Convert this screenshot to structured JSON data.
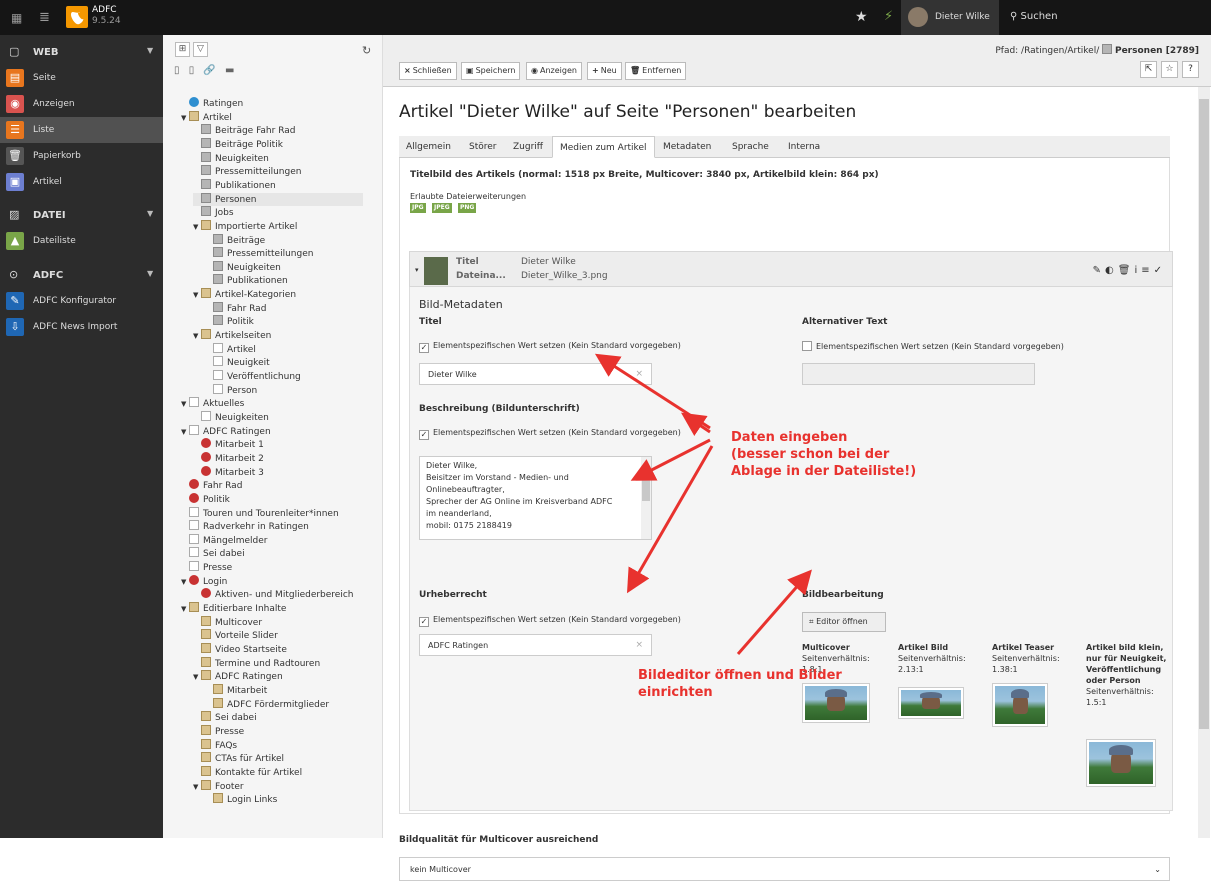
{
  "topbar": {
    "brand_name": "ADFC",
    "brand_version": "9.5.24",
    "user_name": "Dieter Wilke",
    "search_label": "Suchen"
  },
  "sidebar": {
    "groups": [
      {
        "label": "WEB",
        "items": [
          {
            "label": "Seite",
            "color": "#e8761e",
            "icon": "page-icon"
          },
          {
            "label": "Anzeigen",
            "color": "#d9534f",
            "icon": "view-icon"
          },
          {
            "label": "Liste",
            "color": "#e8761e",
            "icon": "list-icon",
            "active": true
          },
          {
            "label": "Papierkorb",
            "color": "#555555",
            "icon": "trash-icon"
          },
          {
            "label": "Artikel",
            "color": "#6d7fd1",
            "icon": "news-icon"
          }
        ]
      },
      {
        "label": "DATEI",
        "items": [
          {
            "label": "Dateiliste",
            "color": "#79a548",
            "icon": "filelist-icon"
          }
        ]
      },
      {
        "label": "ADFC",
        "items": [
          {
            "label": "ADFC Konfigurator",
            "color": "#1f67b4",
            "icon": "configurator-icon"
          },
          {
            "label": "ADFC News Import",
            "color": "#1f67b4",
            "icon": "import-icon"
          }
        ]
      }
    ]
  },
  "tree": {
    "nodes": [
      {
        "label": "Ratingen",
        "level": 0,
        "icon": "root"
      },
      {
        "label": "Artikel",
        "level": 0,
        "icon": "folder",
        "expanded": true
      },
      {
        "label": "Beiträge Fahr Rad",
        "level": 1,
        "icon": "art"
      },
      {
        "label": "Beiträge Politik",
        "level": 1,
        "icon": "art"
      },
      {
        "label": "Neuigkeiten",
        "level": 1,
        "icon": "art"
      },
      {
        "label": "Pressemitteilungen",
        "level": 1,
        "icon": "art"
      },
      {
        "label": "Publikationen",
        "level": 1,
        "icon": "art"
      },
      {
        "label": "Personen",
        "level": 1,
        "icon": "art",
        "selected": true
      },
      {
        "label": "Jobs",
        "level": 1,
        "icon": "art"
      },
      {
        "label": "Importierte Artikel",
        "level": 1,
        "icon": "folder",
        "expanded": true
      },
      {
        "label": "Beiträge",
        "level": 2,
        "icon": "art"
      },
      {
        "label": "Pressemitteilungen",
        "level": 2,
        "icon": "art"
      },
      {
        "label": "Neuigkeiten",
        "level": 2,
        "icon": "art"
      },
      {
        "label": "Publikationen",
        "level": 2,
        "icon": "art"
      },
      {
        "label": "Artikel-Kategorien",
        "level": 1,
        "icon": "folder",
        "expanded": true
      },
      {
        "label": "Fahr Rad",
        "level": 2,
        "icon": "art"
      },
      {
        "label": "Politik",
        "level": 2,
        "icon": "art"
      },
      {
        "label": "Artikelseiten",
        "level": 1,
        "icon": "folder",
        "expanded": true
      },
      {
        "label": "Artikel",
        "level": 2,
        "icon": "page"
      },
      {
        "label": "Neuigkeit",
        "level": 2,
        "icon": "page"
      },
      {
        "label": "Veröffentlichung",
        "level": 2,
        "icon": "page"
      },
      {
        "label": "Person",
        "level": 2,
        "icon": "page"
      },
      {
        "label": "Aktuelles",
        "level": 0,
        "icon": "page",
        "expanded": true
      },
      {
        "label": "Neuigkeiten",
        "level": 1,
        "icon": "page"
      },
      {
        "label": "ADFC Ratingen",
        "level": 0,
        "icon": "page",
        "expanded": true
      },
      {
        "label": "Mitarbeit 1",
        "level": 1,
        "icon": "red"
      },
      {
        "label": "Mitarbeit 2",
        "level": 1,
        "icon": "red"
      },
      {
        "label": "Mitarbeit 3",
        "level": 1,
        "icon": "red"
      },
      {
        "label": "Fahr Rad",
        "level": 0,
        "icon": "red"
      },
      {
        "label": "Politik",
        "level": 0,
        "icon": "red"
      },
      {
        "label": "Touren und Tourenleiter*innen",
        "level": 0,
        "icon": "page"
      },
      {
        "label": "Radverkehr in Ratingen",
        "level": 0,
        "icon": "page"
      },
      {
        "label": "Mängelmelder",
        "level": 0,
        "icon": "page"
      },
      {
        "label": "Sei dabei",
        "level": 0,
        "icon": "page"
      },
      {
        "label": "Presse",
        "level": 0,
        "icon": "page"
      },
      {
        "label": "Login",
        "level": 0,
        "icon": "red",
        "expanded": true
      },
      {
        "label": "Aktiven- und Mitgliederbereich",
        "level": 1,
        "icon": "red"
      },
      {
        "label": "Editierbare Inhalte",
        "level": 0,
        "icon": "folder",
        "expanded": true
      },
      {
        "label": "Multicover",
        "level": 1,
        "icon": "folder"
      },
      {
        "label": "Vorteile Slider",
        "level": 1,
        "icon": "folder"
      },
      {
        "label": "Video Startseite",
        "level": 1,
        "icon": "folder"
      },
      {
        "label": "Termine und Radtouren",
        "level": 1,
        "icon": "folder"
      },
      {
        "label": "ADFC Ratingen",
        "level": 1,
        "icon": "folder",
        "expanded": true
      },
      {
        "label": "Mitarbeit",
        "level": 2,
        "icon": "folder"
      },
      {
        "label": "ADFC Fördermitglieder",
        "level": 2,
        "icon": "folder"
      },
      {
        "label": "Sei dabei",
        "level": 1,
        "icon": "folder"
      },
      {
        "label": "Presse",
        "level": 1,
        "icon": "folder"
      },
      {
        "label": "FAQs",
        "level": 1,
        "icon": "folder"
      },
      {
        "label": "CTAs für Artikel",
        "level": 1,
        "icon": "folder"
      },
      {
        "label": "Kontakte für Artikel",
        "level": 1,
        "icon": "folder"
      },
      {
        "label": "Footer",
        "level": 1,
        "icon": "folder",
        "expanded": true
      },
      {
        "label": "Login Links",
        "level": 2,
        "icon": "folder"
      }
    ]
  },
  "docheader": {
    "path_label": "Pfad: /Ratingen/Artikel/",
    "path_page": "Personen [2789]",
    "buttons": [
      {
        "label": "Schließen",
        "icon": "×"
      },
      {
        "label": "Speichern",
        "icon": "▣"
      },
      {
        "label": "Anzeigen",
        "icon": "◉"
      },
      {
        "label": "Neu",
        "icon": "+"
      },
      {
        "label": "Entfernen",
        "icon": "🗑"
      }
    ]
  },
  "editor": {
    "title": "Artikel \"Dieter Wilke\" auf Seite \"Personen\" bearbeiten",
    "tabs": [
      "Allgemein",
      "Störer",
      "Zugriff",
      "Medien zum Artikel",
      "Metadaten",
      "Sprache",
      "Interna"
    ],
    "active_tab": "Medien zum Artikel",
    "field_heading": "Titelbild des Artikels (normal: 1518 px Breite, Multicover: 3840 px, Artikelbild klein: 864 px)",
    "allowed_label": "Erlaubte Dateierweiterungen",
    "extensions": [
      "JPG",
      "JPEG",
      "PNG"
    ],
    "file": {
      "title_key": "Titel",
      "title_value": "Dieter Wilke",
      "filename_key": "Dateina...",
      "filename_value": "Dieter_Wilke_3.png"
    },
    "meta_title": "Bild-Metadaten",
    "titel_label": "Titel",
    "alt_label": "Alternativer Text",
    "override_label": "Elementspezifischen Wert setzen (Kein Standard vorgegeben)",
    "titel_value": "Dieter Wilke",
    "beschreibung_label": "Beschreibung (Bildunterschrift)",
    "beschreibung_lines": [
      "Dieter Wilke,",
      "Beisitzer im Vorstand - Medien- und",
      "Onlinebeauftragter,",
      "Sprecher der AG Online im Kreisverband ADFC",
      "im neanderland,",
      "mobil: 0175 2188419"
    ],
    "urheber_label": "Urheberrecht",
    "urheber_value": "ADFC Ratingen",
    "bildbearbeitung_label": "Bildbearbeitung",
    "editor_button": "Editor öffnen",
    "crops": [
      {
        "name": "Multicover",
        "ratio_label": "Seitenverhältnis:",
        "ratio": "1.8:1"
      },
      {
        "name": "Artikel Bild",
        "ratio_label": "Seitenverhältnis:",
        "ratio": "2.13:1"
      },
      {
        "name": "Artikel Teaser",
        "ratio_label": "Seitenverhältnis:",
        "ratio": "1.38:1"
      },
      {
        "name": "Artikel bild klein, nur für Neuigkeit, Veröffentlichung oder Person",
        "ratio_label": "Seitenverhältnis:",
        "ratio": "1.5:1"
      }
    ],
    "quality_label": "Bildqualität für Multicover ausreichend",
    "quality_value": "kein Multicover"
  },
  "annotations": {
    "data_lines": [
      "Daten eingeben",
      "(besser schon bei der",
      "Ablage in der Dateiliste!)"
    ],
    "editor_lines": [
      "Bildeditor öffnen und Bilder",
      "einrichten"
    ],
    "color": "#e8322e"
  }
}
